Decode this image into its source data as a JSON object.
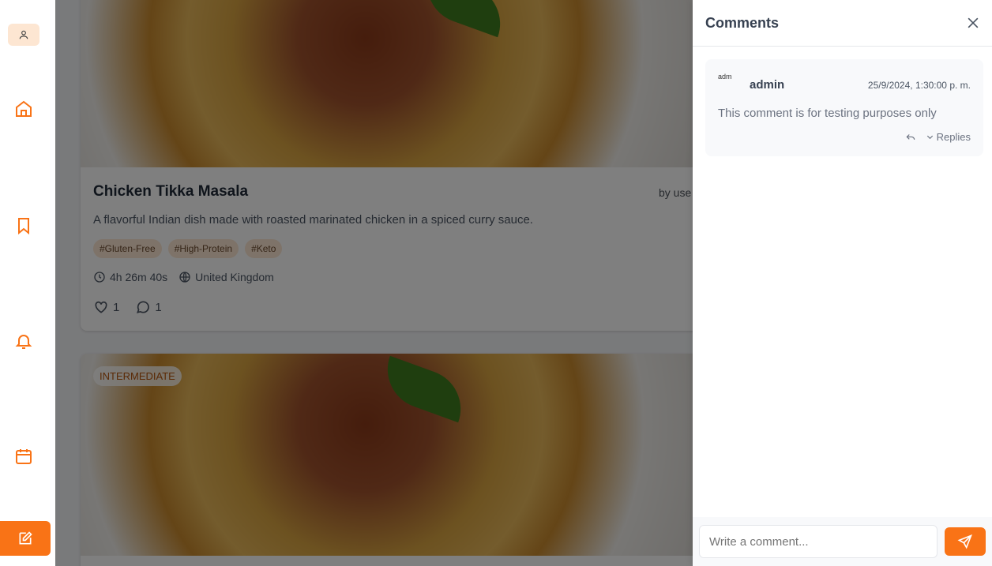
{
  "sidebar": {
    "items": [
      {
        "icon": "user-icon"
      },
      {
        "icon": "home-icon"
      },
      {
        "icon": "bookmark-icon"
      },
      {
        "icon": "bell-icon"
      },
      {
        "icon": "calendar-icon"
      },
      {
        "icon": "edit-icon"
      }
    ],
    "accent": "#f97316"
  },
  "feed": {
    "cards": [
      {
        "title": "Chicken Tikka Masala",
        "author": "by use",
        "description": "A flavorful Indian dish made with roasted marinated chicken in a spiced curry sauce.",
        "tags": [
          "#Gluten-Free",
          "#High-Protein",
          "#Keto"
        ],
        "duration": "4h 26m 40s",
        "country": "United Kingdom",
        "likes": "1",
        "comments": "1"
      },
      {
        "difficulty": "INTERMEDIATE"
      }
    ]
  },
  "comments_panel": {
    "title": "Comments",
    "comments": [
      {
        "avatar_alt": "adm",
        "user": "admin",
        "time": "25/9/2024, 1:30:00 p. m.",
        "text": "This comment is for testing purposes only",
        "replies_label": "Replies"
      }
    ],
    "input_placeholder": "Write a comment..."
  }
}
